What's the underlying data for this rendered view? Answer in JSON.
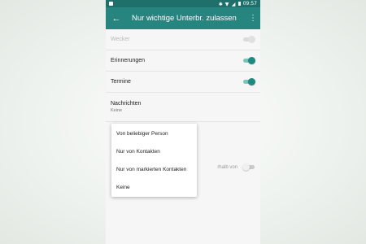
{
  "status_bar": {
    "time": "09:57",
    "icons": [
      "bluetooth-icon",
      "wifi-icon",
      "signal-icon",
      "battery-icon"
    ]
  },
  "app_bar": {
    "title": "Nur wichtige Unterbr. zulassen",
    "back_icon": "arrow-back-icon",
    "more_icon": "more-vert-icon"
  },
  "settings": [
    {
      "label": "Wecker",
      "toggle": "on",
      "enabled": false
    },
    {
      "label": "Erinnerungen",
      "toggle": "on",
      "enabled": true
    },
    {
      "label": "Termine",
      "toggle": "on",
      "enabled": true
    },
    {
      "label": "Nachrichten",
      "value": "Keine"
    }
  ],
  "hidden_row": {
    "partial_text": "rhalb von",
    "toggle": "off"
  },
  "menu": {
    "options": [
      "Von beliebiger Person",
      "Nur von Kontakten",
      "Nur von markierten Kontakten",
      "Keine"
    ]
  },
  "colors": {
    "app_bar": "#26857f",
    "status_bar": "#1f6f6a",
    "accent": "#1f8a80"
  }
}
